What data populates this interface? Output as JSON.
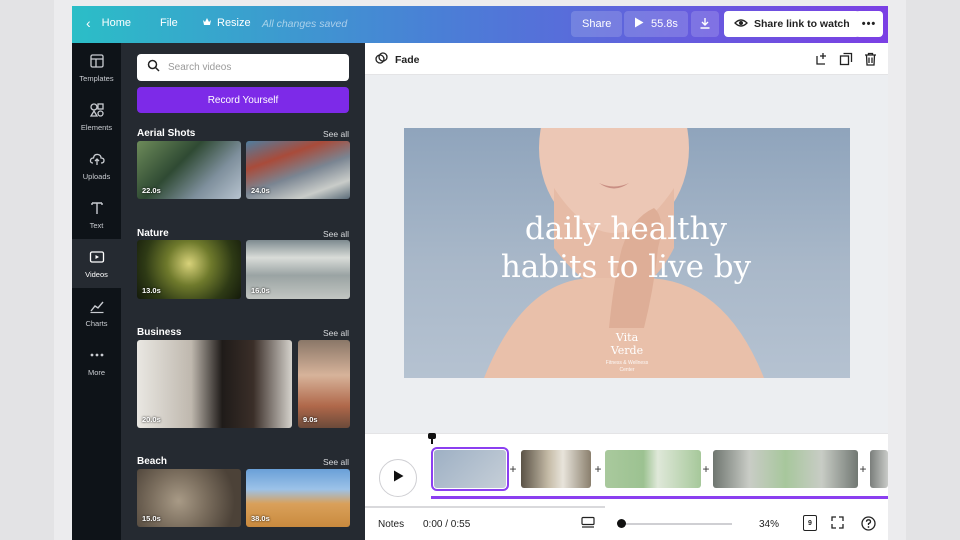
{
  "topbar": {
    "home_label": "Home",
    "file_label": "File",
    "resize_label": "Resize",
    "saved_status": "All changes saved",
    "share_label": "Share",
    "play_duration": "55.8s",
    "share_link_label": "Share link to watch"
  },
  "rail": {
    "items": [
      {
        "label": "Templates",
        "icon": "templates-icon"
      },
      {
        "label": "Elements",
        "icon": "elements-icon"
      },
      {
        "label": "Uploads",
        "icon": "uploads-icon"
      },
      {
        "label": "Text",
        "icon": "text-icon"
      },
      {
        "label": "Videos",
        "icon": "videos-icon",
        "active": true
      },
      {
        "label": "Charts",
        "icon": "charts-icon"
      },
      {
        "label": "More",
        "icon": "more-icon"
      }
    ]
  },
  "panel": {
    "search_placeholder": "Search videos",
    "record_label": "Record Yourself",
    "see_all": "See all",
    "sections": [
      {
        "title": "Aerial Shots",
        "durations": [
          "22.0s",
          "24.0s"
        ]
      },
      {
        "title": "Nature",
        "durations": [
          "13.0s",
          "16.0s"
        ]
      },
      {
        "title": "Business",
        "durations": [
          "20.0s",
          "9.0s"
        ]
      },
      {
        "title": "Beach",
        "durations": [
          "15.0s",
          "38.0s"
        ]
      }
    ]
  },
  "editor": {
    "transition_label": "Fade"
  },
  "slide": {
    "headline_line1": "daily healthy",
    "headline_line2": "habits to live by",
    "brand_line1": "Vita",
    "brand_line2": "Verde",
    "brand_sub1": "Fitness & Wellness",
    "brand_sub2": "Center"
  },
  "bottombar": {
    "notes_label": "Notes",
    "time": "0:00 / 0:55",
    "zoom": "34%",
    "pages": "9"
  },
  "colors": {
    "accent": "#7d2ae8",
    "gradient_start": "#2bbec7",
    "gradient_end": "#7b3fe4",
    "panel_bg": "#252a31",
    "rail_bg": "#0e1318"
  }
}
